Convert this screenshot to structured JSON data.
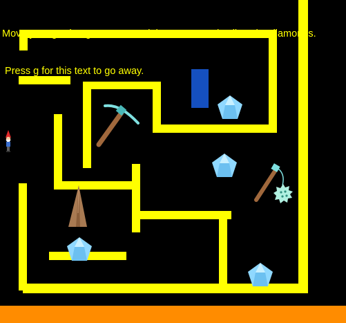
{
  "instructions": {
    "line1": "Move your garden gnome around the course and collect the diamonds.",
    "line2": " Press g for this text to go away."
  },
  "colors": {
    "background": "#000000",
    "text": "#ffff00",
    "wall": "#ffff00",
    "ground": "#ff8c00",
    "door": "#1550c0",
    "diamond": "#8fd8ff"
  },
  "sprites": {
    "player": "garden-gnome-icon",
    "collectible": "diamond-icon",
    "tools": [
      "pickaxe-icon",
      "mace-icon"
    ],
    "obstacle": "stalagmite-icon"
  }
}
